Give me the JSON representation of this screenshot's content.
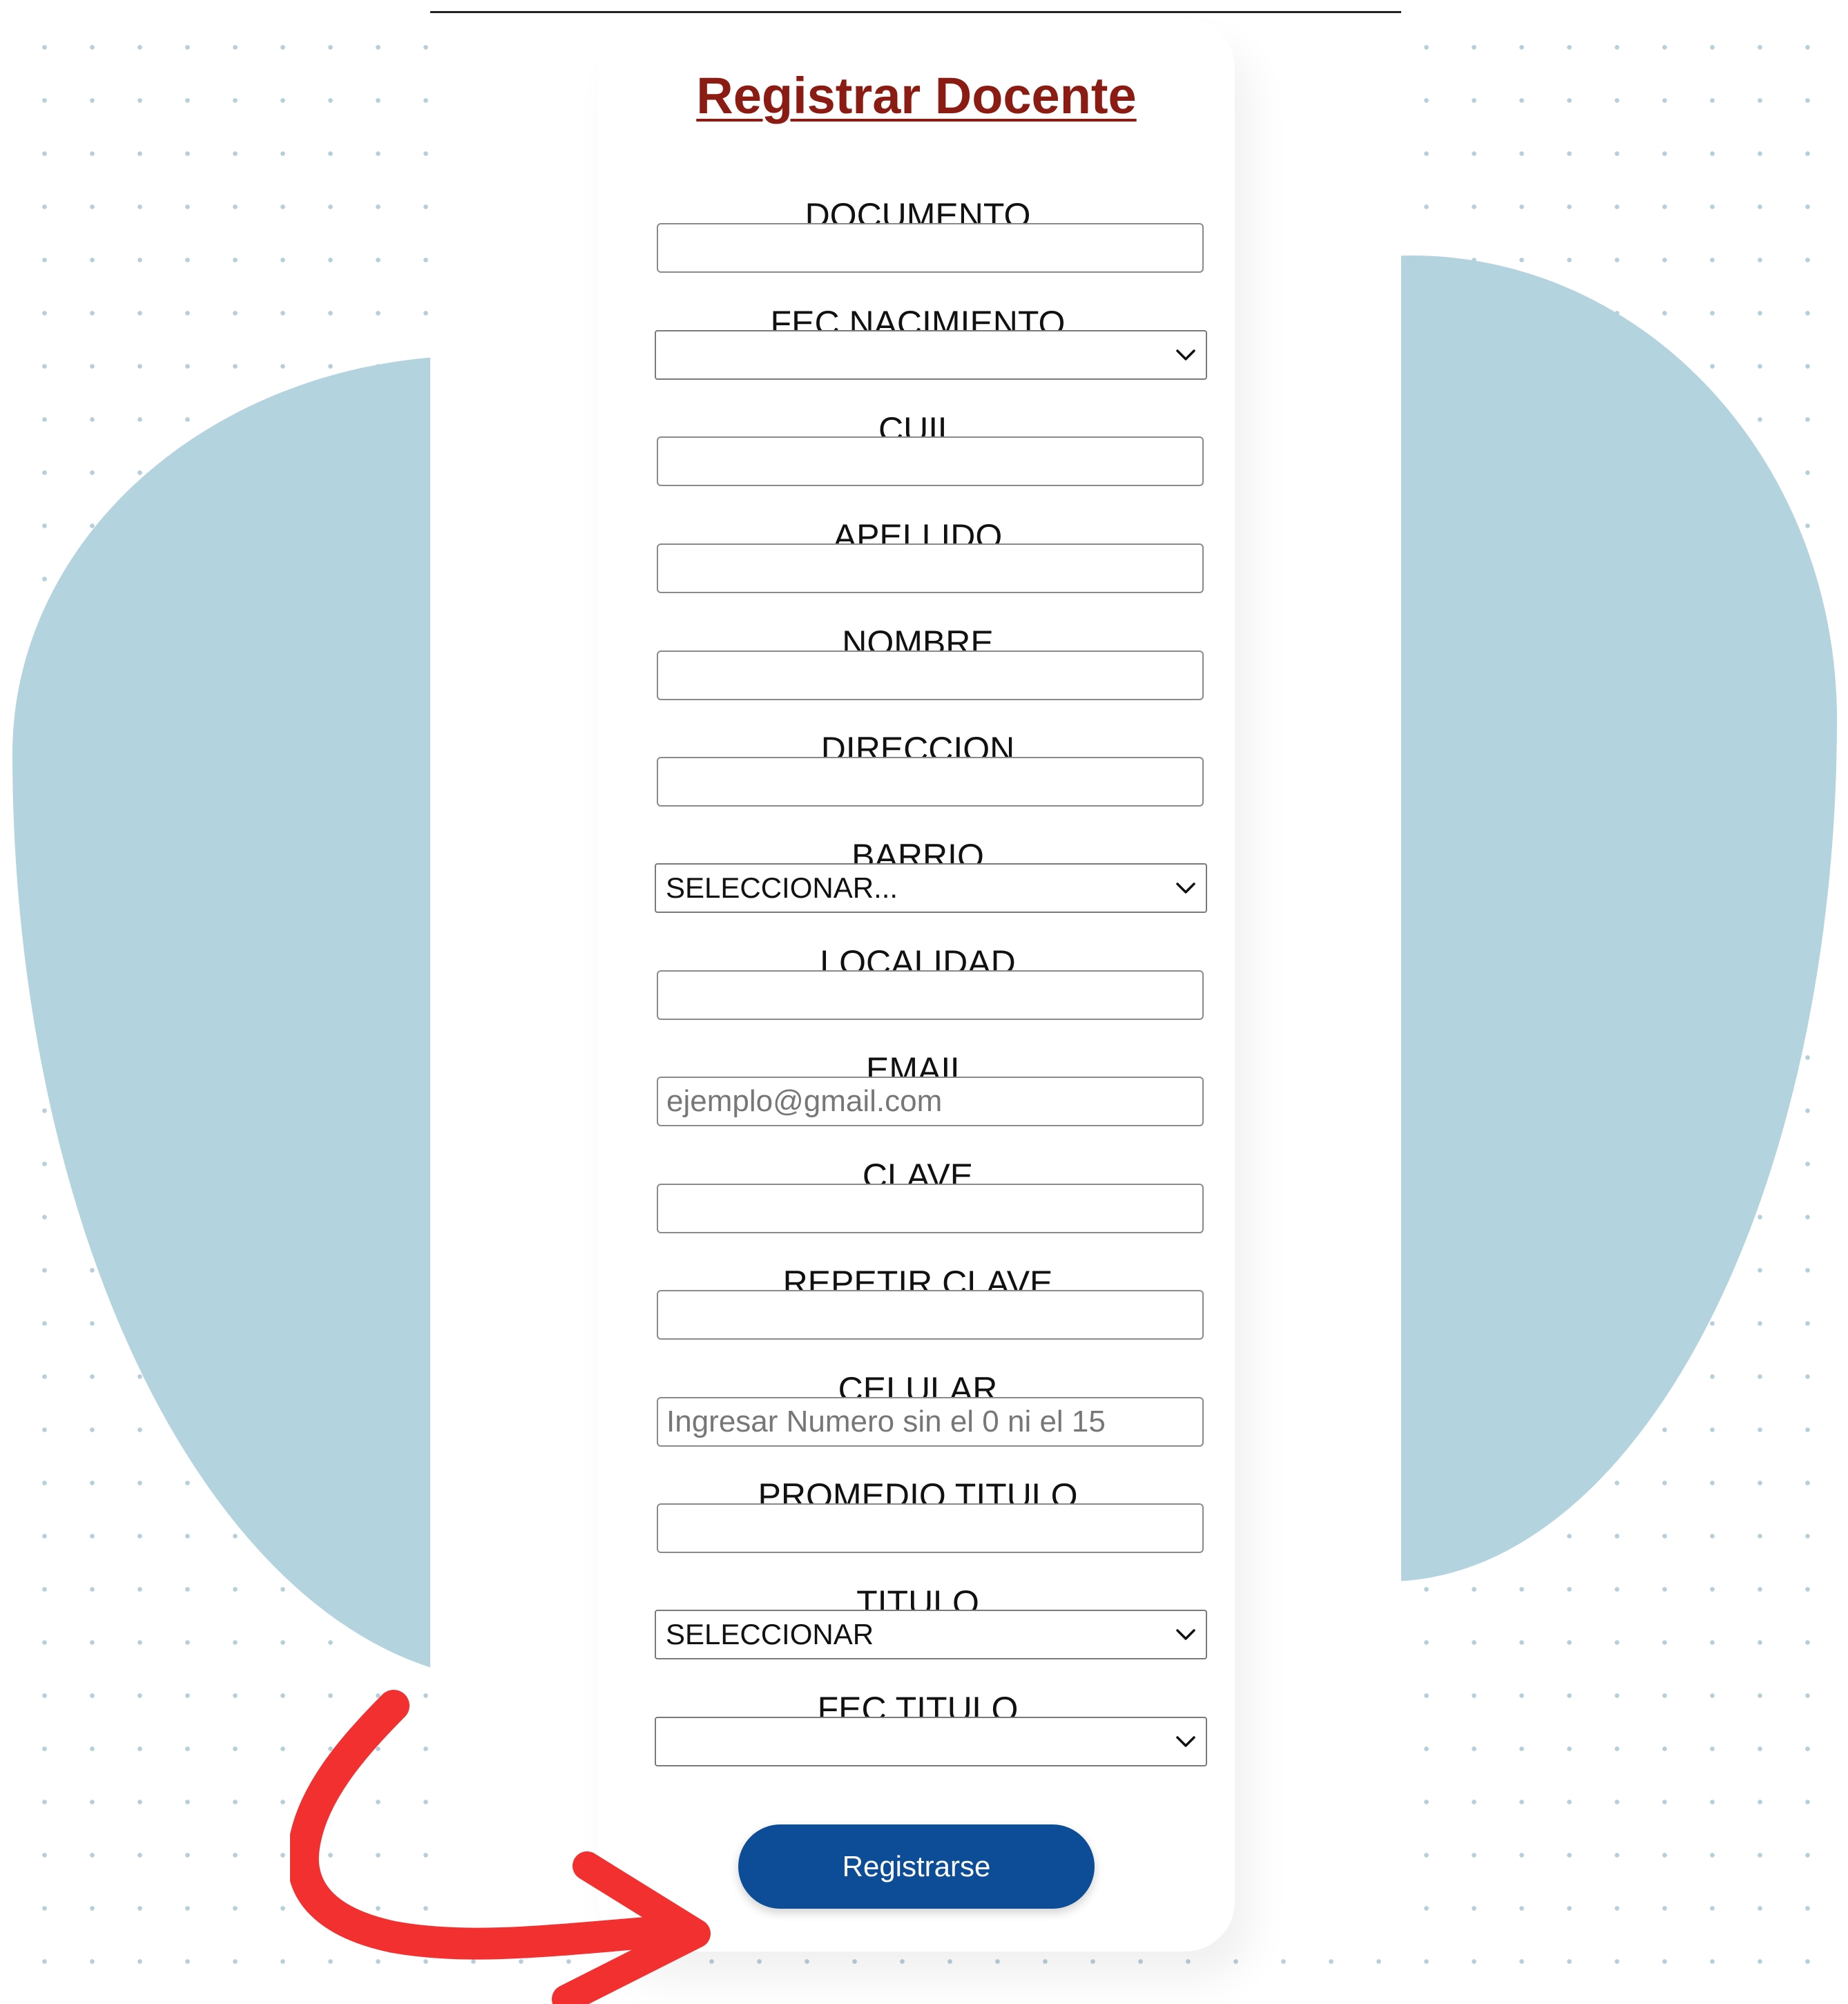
{
  "form": {
    "title": "Registrar Docente",
    "fields": [
      {
        "label": "DOCUMENTO",
        "kind": "text",
        "value": "",
        "placeholder": ""
      },
      {
        "label": "FEC NACIMIENTO",
        "kind": "select",
        "value": ""
      },
      {
        "label": "CUIL",
        "kind": "text",
        "value": "",
        "placeholder": ""
      },
      {
        "label": "APELLIDO",
        "kind": "text",
        "value": "",
        "placeholder": ""
      },
      {
        "label": "NOMBRE",
        "kind": "text",
        "value": "",
        "placeholder": ""
      },
      {
        "label": "DIRECCION",
        "kind": "text",
        "value": "",
        "placeholder": ""
      },
      {
        "label": "BARRIO",
        "kind": "select",
        "value": "SELECCIONAR..."
      },
      {
        "label": "LOCALIDAD",
        "kind": "text",
        "value": "",
        "placeholder": ""
      },
      {
        "label": "EMAIL",
        "kind": "text",
        "value": "",
        "placeholder": "ejemplo@gmail.com"
      },
      {
        "label": "CLAVE",
        "kind": "text",
        "value": "",
        "placeholder": ""
      },
      {
        "label": "REPETIR CLAVE",
        "kind": "text",
        "value": "",
        "placeholder": ""
      },
      {
        "label": "CELULAR",
        "kind": "text",
        "value": "",
        "placeholder": "Ingresar Numero sin el 0 ni el 15"
      },
      {
        "label": "PROMEDIO TITULO",
        "kind": "text",
        "value": "",
        "placeholder": ""
      },
      {
        "label": "TITULO",
        "kind": "select",
        "value": "SELECCIONAR"
      },
      {
        "label": "FEC TITULO",
        "kind": "select",
        "value": ""
      }
    ],
    "submit_label": "Registrarse"
  },
  "colors": {
    "title": "#8b1c14",
    "button": "#0d4d97",
    "blob": "#b3d4df",
    "arrow": "#f23030",
    "dots": "#b6cfda"
  },
  "icons": {
    "select_chevron": "chevron-down-icon",
    "annotation": "curved-arrow-icon"
  }
}
